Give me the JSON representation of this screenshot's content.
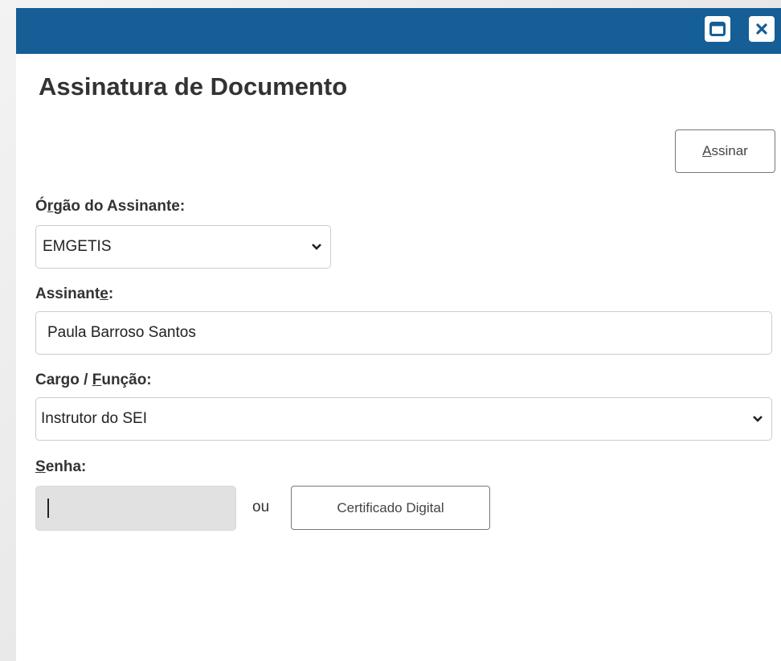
{
  "dialog": {
    "heading": "Assinatura de Documento",
    "titlebar_color": "#155e96",
    "buttons": [
      {
        "name": "maximize",
        "icon": "maximize-icon"
      },
      {
        "name": "close",
        "icon": "close-icon"
      }
    ]
  },
  "actions": {
    "sign_label_accesskey": "A",
    "sign_label_rest": "ssinar"
  },
  "form": {
    "orgao": {
      "label_pre": "Ó",
      "label_key": "r",
      "label_post": "gão do Assinante:",
      "value": "EMGETIS"
    },
    "assinante": {
      "label_pre": "Assinant",
      "label_key": "e",
      "label_post": ":",
      "value": "Paula Barroso Santos"
    },
    "cargo": {
      "label_pre": "Cargo / ",
      "label_key": "F",
      "label_post": "unção:",
      "value": "Instrutor do SEI"
    },
    "senha": {
      "label_key": "S",
      "label_post": "enha:",
      "value": ""
    },
    "or_text": "ou",
    "cert_button": "Certificado Digital"
  }
}
